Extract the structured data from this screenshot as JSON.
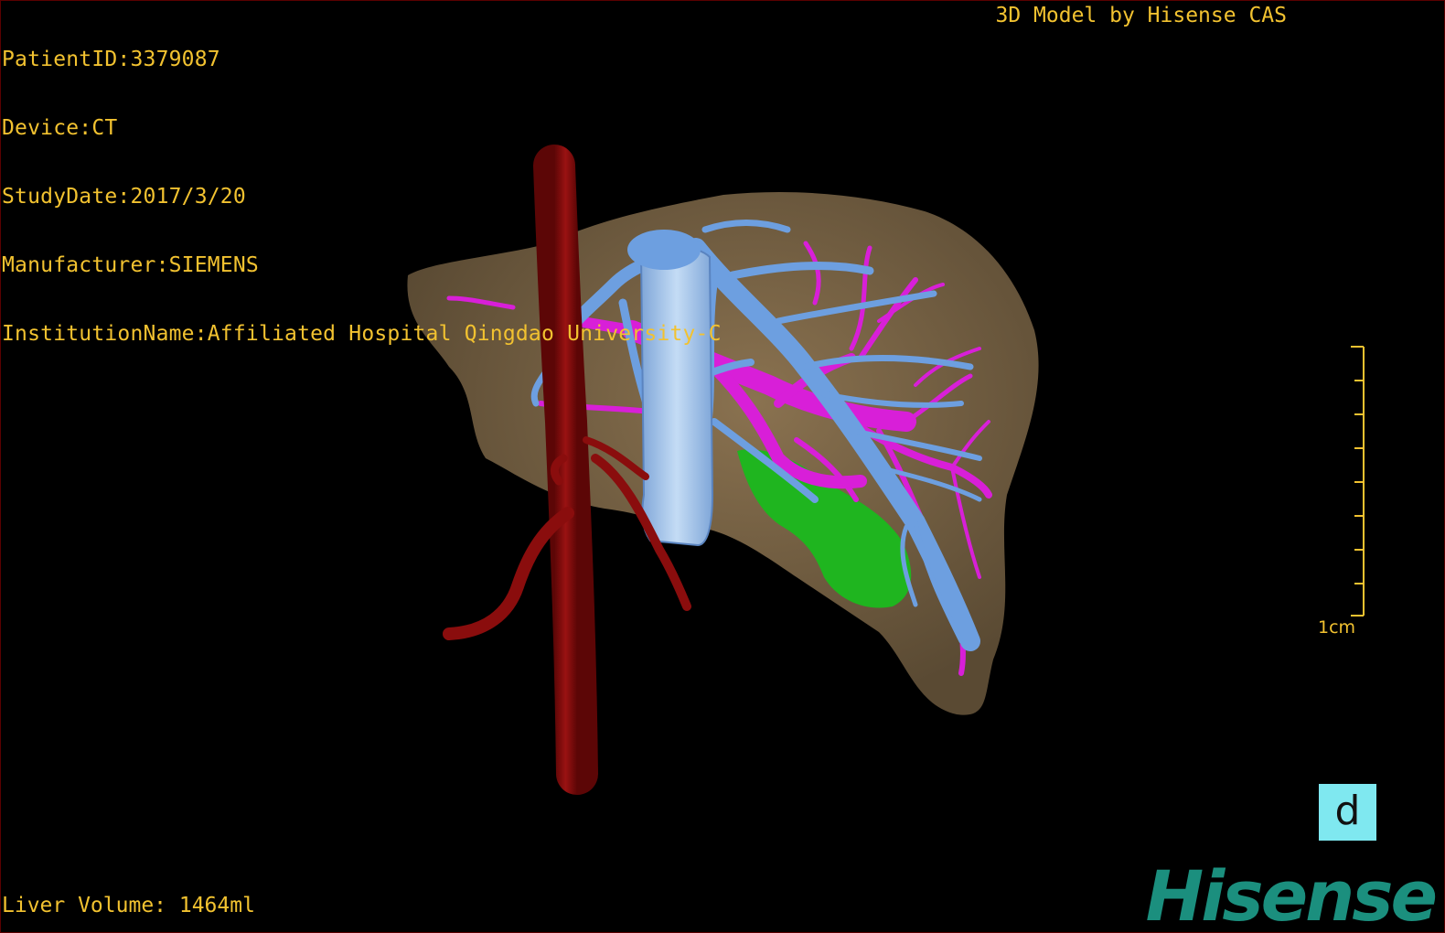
{
  "header": {
    "patient_id": "PatientID:3379087",
    "device": "Device:CT",
    "study_date": "StudyDate:2017/3/20",
    "manufacturer": "Manufacturer:SIEMENS",
    "institution": "InstitutionName:Affiliated Hospital Qingdao University-C",
    "model_credit": "3D Model by Hisense CAS"
  },
  "footer": {
    "liver_volume": "Liver Volume: 1464ml",
    "brand": "Hisense"
  },
  "scale_bar": {
    "label": "1cm"
  },
  "view_badge": {
    "label": "d"
  },
  "colors": {
    "text": "#f2c230",
    "liver": "#7a6445",
    "aorta": "#8a0d0d",
    "hepatic_veins": "#6d9fe0",
    "portal_vein": "#d81fd8",
    "gallbladder": "#1fb51f",
    "badge": "#7fe8f0",
    "brand": "#1b8f7e"
  }
}
